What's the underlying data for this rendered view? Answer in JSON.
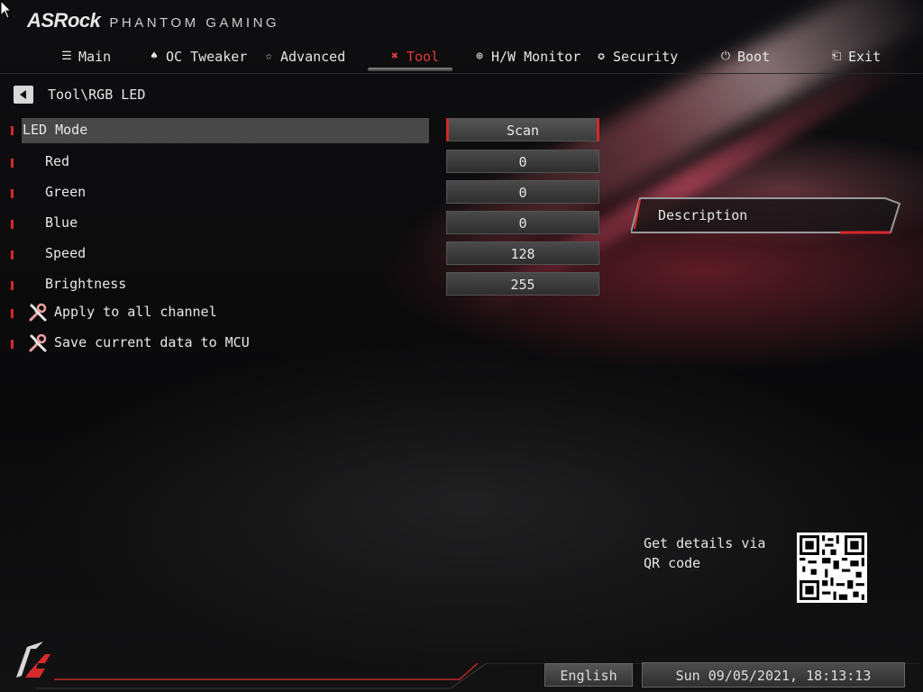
{
  "header": {
    "brand": "ASRock",
    "subtitle": "PHANTOM GAMING"
  },
  "nav": {
    "tabs": [
      {
        "label": "Main",
        "icon": "list-icon"
      },
      {
        "label": "OC Tweaker",
        "icon": "rocket-icon"
      },
      {
        "label": "Advanced",
        "icon": "star-icon"
      },
      {
        "label": "Tool",
        "icon": "tools-icon",
        "active": true
      },
      {
        "label": "H/W Monitor",
        "icon": "crosshair-icon"
      },
      {
        "label": "Security",
        "icon": "shield-icon"
      },
      {
        "label": "Boot",
        "icon": "power-icon"
      },
      {
        "label": "Exit",
        "icon": "exit-door-icon"
      }
    ]
  },
  "breadcrumb": "Tool\\RGB LED",
  "settings": [
    {
      "label": "LED Mode",
      "value": "Scan"
    },
    {
      "label": "Red",
      "value": "0"
    },
    {
      "label": "Green",
      "value": "0"
    },
    {
      "label": "Blue",
      "value": "0"
    },
    {
      "label": "Speed",
      "value": "128"
    },
    {
      "label": "Brightness",
      "value": "255"
    }
  ],
  "actions": [
    {
      "label": "Apply to all channel",
      "icon": "tools-icon"
    },
    {
      "label": "Save current data to MCU",
      "icon": "tools-icon"
    }
  ],
  "description": {
    "title": "Description"
  },
  "qr": {
    "text": "Get details via QR code"
  },
  "footer": {
    "language": "English",
    "datetime": "Sun 09/05/2021, 18:13:13"
  },
  "colors": {
    "accent": "#d42a2a",
    "background": "#0b0b0c",
    "text": "#e6e6e6"
  }
}
